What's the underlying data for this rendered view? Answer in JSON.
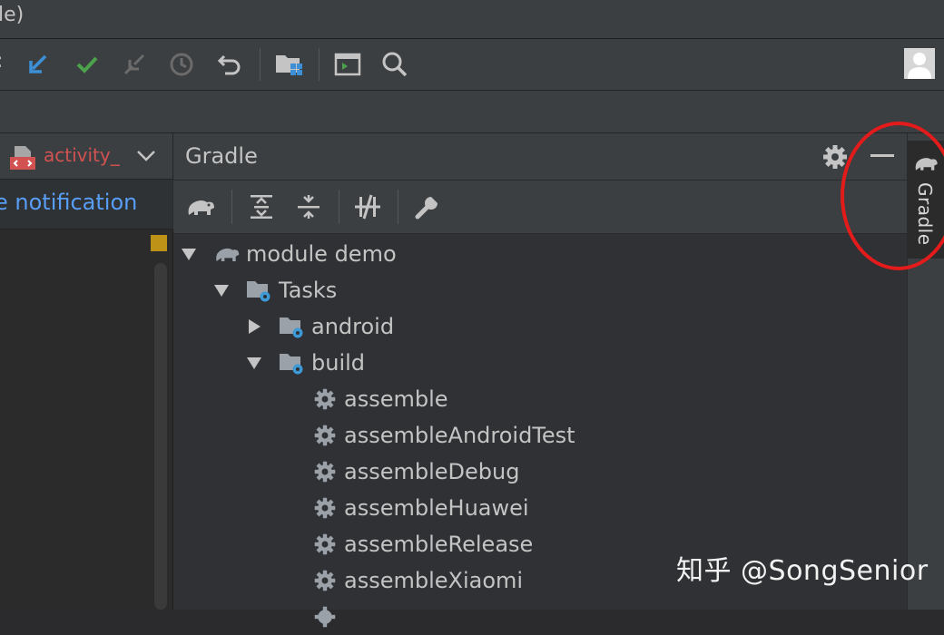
{
  "window": {
    "title_fragment": "le)"
  },
  "toolbar": {
    "lead_text": ":",
    "buttons": [
      {
        "icon": "vcs-update-icon",
        "color": "#3d8fd6"
      },
      {
        "icon": "vcs-commit-icon",
        "color": "#4ba24b"
      },
      {
        "icon": "vcs-merge-icon",
        "color": "#6b6b6b"
      },
      {
        "icon": "history-icon",
        "color": "#6b6b6b"
      },
      {
        "icon": "revert-icon",
        "color": "#c4c4c4"
      },
      {
        "icon": "project-structure-icon",
        "color": "#c4c4c4"
      },
      {
        "icon": "terminal-icon",
        "color": "#c4c4c4"
      },
      {
        "icon": "search-icon",
        "color": "#c4c4c4"
      }
    ],
    "avatar_icon": "user-avatar-icon"
  },
  "editor": {
    "tab_label": "activity_",
    "notification_text": "e notification"
  },
  "gradle": {
    "title": "Gradle",
    "tree": {
      "root": "module demo",
      "tasks": "Tasks",
      "groups": [
        {
          "label": "android",
          "expanded": false
        },
        {
          "label": "build",
          "expanded": true
        }
      ],
      "build_tasks": [
        "assemble",
        "assembleAndroidTest",
        "assembleDebug",
        "assembleHuawei",
        "assembleRelease",
        "assembleXiaomi"
      ]
    }
  },
  "side_tab": {
    "label": "Gradle"
  },
  "watermark": "知乎 @SongSenior",
  "colors": {
    "accent_blue": "#589df6",
    "tab_red": "#d25252",
    "highlight_red": "#e41b1b"
  }
}
